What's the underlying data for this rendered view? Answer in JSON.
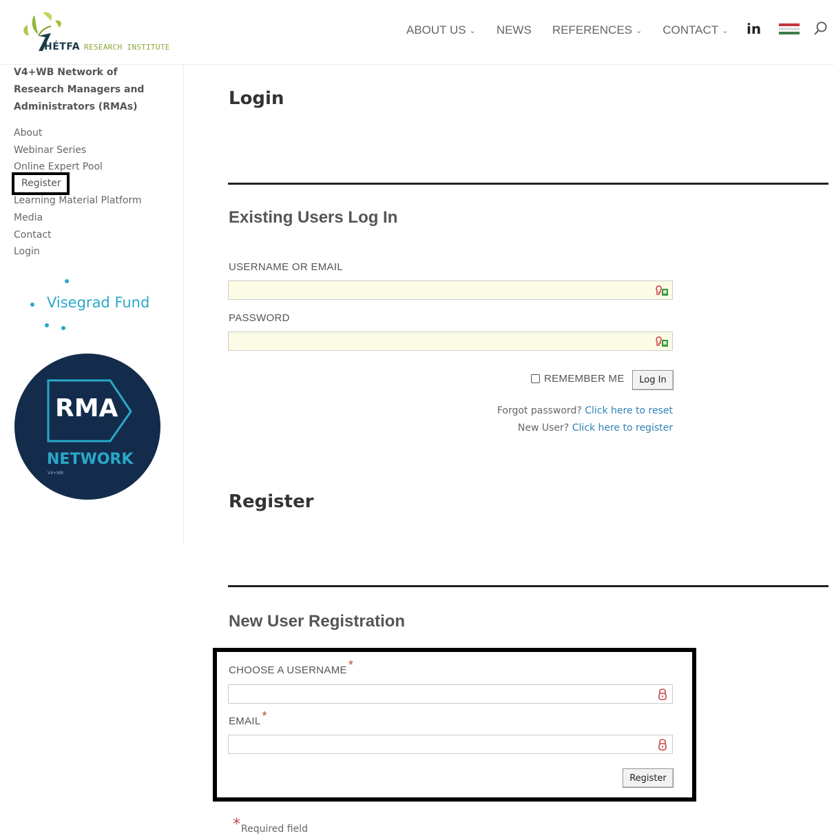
{
  "header": {
    "logo_main": "HÉTFA",
    "logo_sub": "RESEARCH INSTITUTE",
    "nav": [
      {
        "label": "ABOUT US",
        "has_dropdown": true
      },
      {
        "label": "NEWS",
        "has_dropdown": false
      },
      {
        "label": "REFERENCES",
        "has_dropdown": true
      },
      {
        "label": "CONTACT",
        "has_dropdown": true
      }
    ],
    "linkedin": "in",
    "icons": [
      "chevron-down-icon",
      "linkedin-icon",
      "hungarian-flag-icon",
      "search-icon"
    ]
  },
  "sidebar": {
    "title": "V4+WB Network of Research Managers and Administrators (RMAs)",
    "items": [
      {
        "label": "About"
      },
      {
        "label": "Webinar Series"
      },
      {
        "label": "Online Expert Pool"
      },
      {
        "label": "Register"
      },
      {
        "label": "Learning Material Platform"
      },
      {
        "label": "Media"
      },
      {
        "label": "Contact"
      },
      {
        "label": "Login"
      }
    ],
    "visegrad": "Visegrad Fund",
    "rma_logo": {
      "main": "RMA",
      "sub": "NETWORK",
      "tiny": "V4+WB"
    }
  },
  "login": {
    "page_title": "Login",
    "section_title": "Existing Users Log In",
    "username_label": "USERNAME OR EMAIL",
    "username_value": "",
    "password_label": "PASSWORD",
    "password_value": "",
    "remember_label": "REMEMBER ME",
    "remember_checked": false,
    "button": "Log In",
    "forgot_text": "Forgot password?",
    "forgot_link": "Click here to reset",
    "new_user_text": "New User?",
    "new_user_link": "Click here to register"
  },
  "register": {
    "page_title": "Register",
    "section_title": "New User Registration",
    "username_label": "CHOOSE A USERNAME",
    "username_value": "",
    "email_label": "EMAIL",
    "email_value": "",
    "star": "*",
    "button": "Register",
    "required_note": "Required field"
  },
  "colors": {
    "link": "#2f83b9",
    "required_star": "#b94a48",
    "visegrad": "#2aa8c9",
    "rma_bg": "#132c4c",
    "autofill_bg": "#fcfce6"
  }
}
